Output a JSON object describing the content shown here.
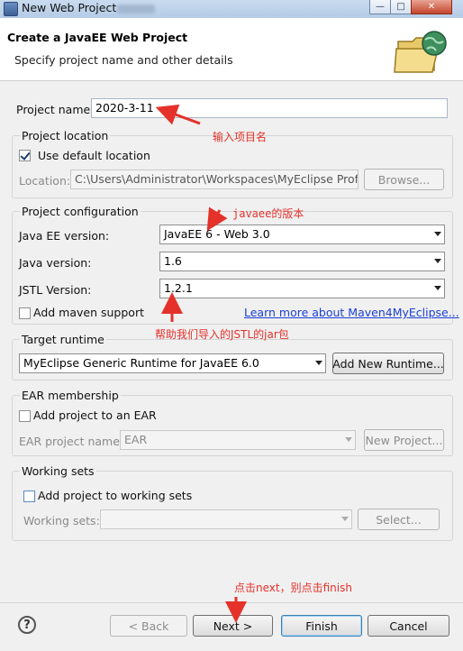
{
  "window": {
    "title": "New Web Project"
  },
  "banner": {
    "title": "Create a JavaEE Web Project",
    "subtitle": "Specify project name and other details"
  },
  "project_name": {
    "label": "Project name:",
    "value": "2020-3-11"
  },
  "location": {
    "group_label": "Project location",
    "use_default_label": "Use default location",
    "use_default_checked": true,
    "location_label": "Location:",
    "location_value": "C:\\Users\\Administrator\\Workspaces\\MyEclipse Profes",
    "browse_label": "Browse..."
  },
  "configuration": {
    "group_label": "Project configuration",
    "javaee_label": "Java EE version:",
    "javaee_value": "JavaEE 6 - Web 3.0",
    "java_label": "Java version:",
    "java_value": "1.6",
    "jstl_label": "JSTL Version:",
    "jstl_value": "1.2.1",
    "maven_label": "Add maven support",
    "maven_link": "Learn more about Maven4MyEclipse..."
  },
  "runtime": {
    "group_label": "Target runtime",
    "value": "MyEclipse Generic Runtime for JavaEE 6.0",
    "add_button": "Add New Runtime..."
  },
  "ear": {
    "group_label": "EAR membership",
    "add_label": "Add project to an EAR",
    "name_label": "EAR project name:",
    "name_value": "EAR",
    "new_button": "New Project..."
  },
  "working_sets": {
    "group_label": "Working sets",
    "add_label": "Add project to working sets",
    "sets_label": "Working sets:",
    "select_button": "Select..."
  },
  "footer": {
    "help": "?",
    "back": "< Back",
    "next": "Next >",
    "finish": "Finish",
    "cancel": "Cancel"
  },
  "annotations": {
    "name_note": "输入项目名",
    "version_note": "javaee的版本",
    "jstl_note": "帮助我们导入的JSTL的jar包",
    "next_note": "点击next，别点击finish"
  },
  "colors": {
    "annotation": "#e4322b",
    "link": "#1a3fd6"
  }
}
